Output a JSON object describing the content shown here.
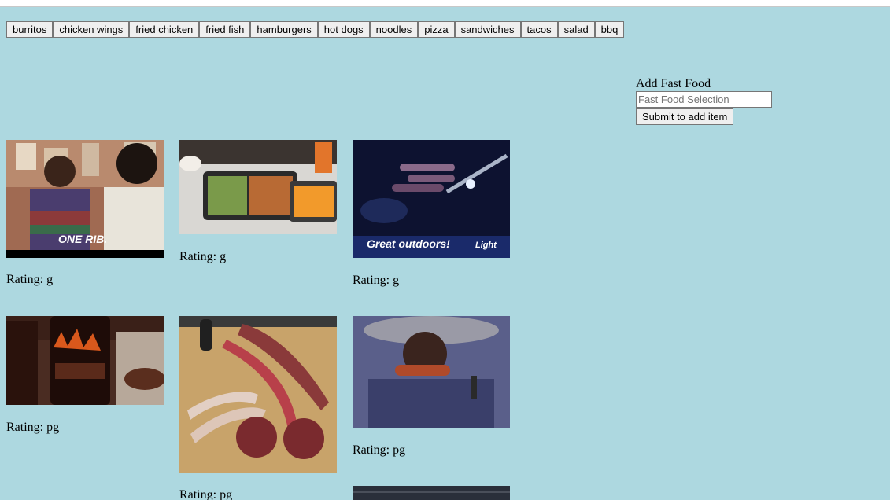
{
  "topics": [
    "burritos",
    "chicken wings",
    "fried chicken",
    "fried fish",
    "hamburgers",
    "hot dogs",
    "noodles",
    "pizza",
    "sandwiches",
    "tacos",
    "salad",
    "bbq"
  ],
  "add_form": {
    "label": "Add Fast Food",
    "placeholder": "Fast Food Selection",
    "submit_label": "Submit to add item"
  },
  "gifs": [
    {
      "rating_text": "Rating: g",
      "caption": "ONE RIB."
    },
    {
      "rating_text": "Rating: g"
    },
    {
      "rating_text": "Rating: g",
      "caption": "Great outdoors!",
      "logo": "Light"
    },
    {
      "rating_text": "Rating: pg"
    },
    {
      "rating_text": "Rating: pg"
    },
    {
      "rating_text": "Rating: pg"
    }
  ]
}
